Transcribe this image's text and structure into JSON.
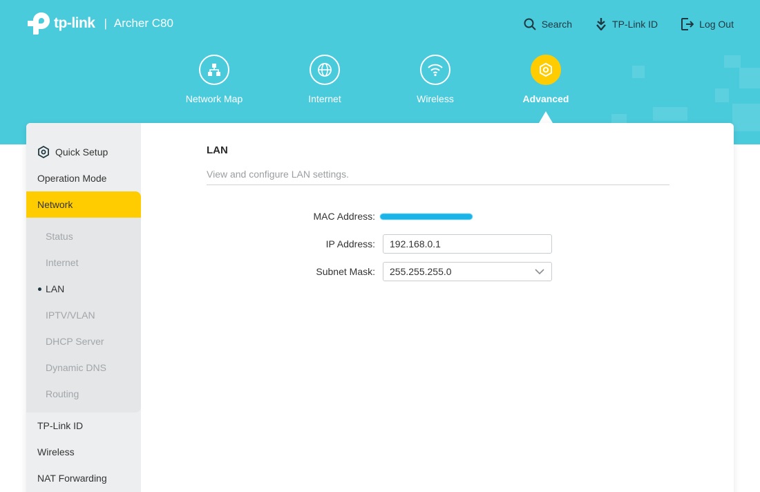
{
  "brand": {
    "logo_text": "tp-link",
    "separator": "|",
    "model": "Archer C80"
  },
  "top_actions": {
    "search": "Search",
    "tplink_id": "TP-Link ID",
    "logout": "Log Out"
  },
  "nav": {
    "items": [
      {
        "label": "Network Map",
        "icon": "network-map-icon"
      },
      {
        "label": "Internet",
        "icon": "globe-icon"
      },
      {
        "label": "Wireless",
        "icon": "wifi-icon"
      },
      {
        "label": "Advanced",
        "icon": "gear-icon"
      }
    ],
    "active": "Advanced"
  },
  "sidebar": {
    "quick_setup": "Quick Setup",
    "operation_mode": "Operation Mode",
    "network": "Network",
    "network_sub": [
      "Status",
      "Internet",
      "LAN",
      "IPTV/VLAN",
      "DHCP Server",
      "Dynamic DNS",
      "Routing"
    ],
    "current_sub": "LAN",
    "after": [
      "TP-Link ID",
      "Wireless",
      "NAT Forwarding"
    ]
  },
  "main": {
    "title": "LAN",
    "description": "View and configure LAN settings.",
    "mac_label": "MAC Address:",
    "ip_label": "IP Address:",
    "ip_value": "192.168.0.1",
    "subnet_label": "Subnet Mask:",
    "subnet_value": "255.255.255.0"
  },
  "colors": {
    "header": "#4acbdc",
    "accent": "#ffcc00",
    "sidebar": "#eceeef",
    "mac_redaction": "#1ab4e8"
  }
}
